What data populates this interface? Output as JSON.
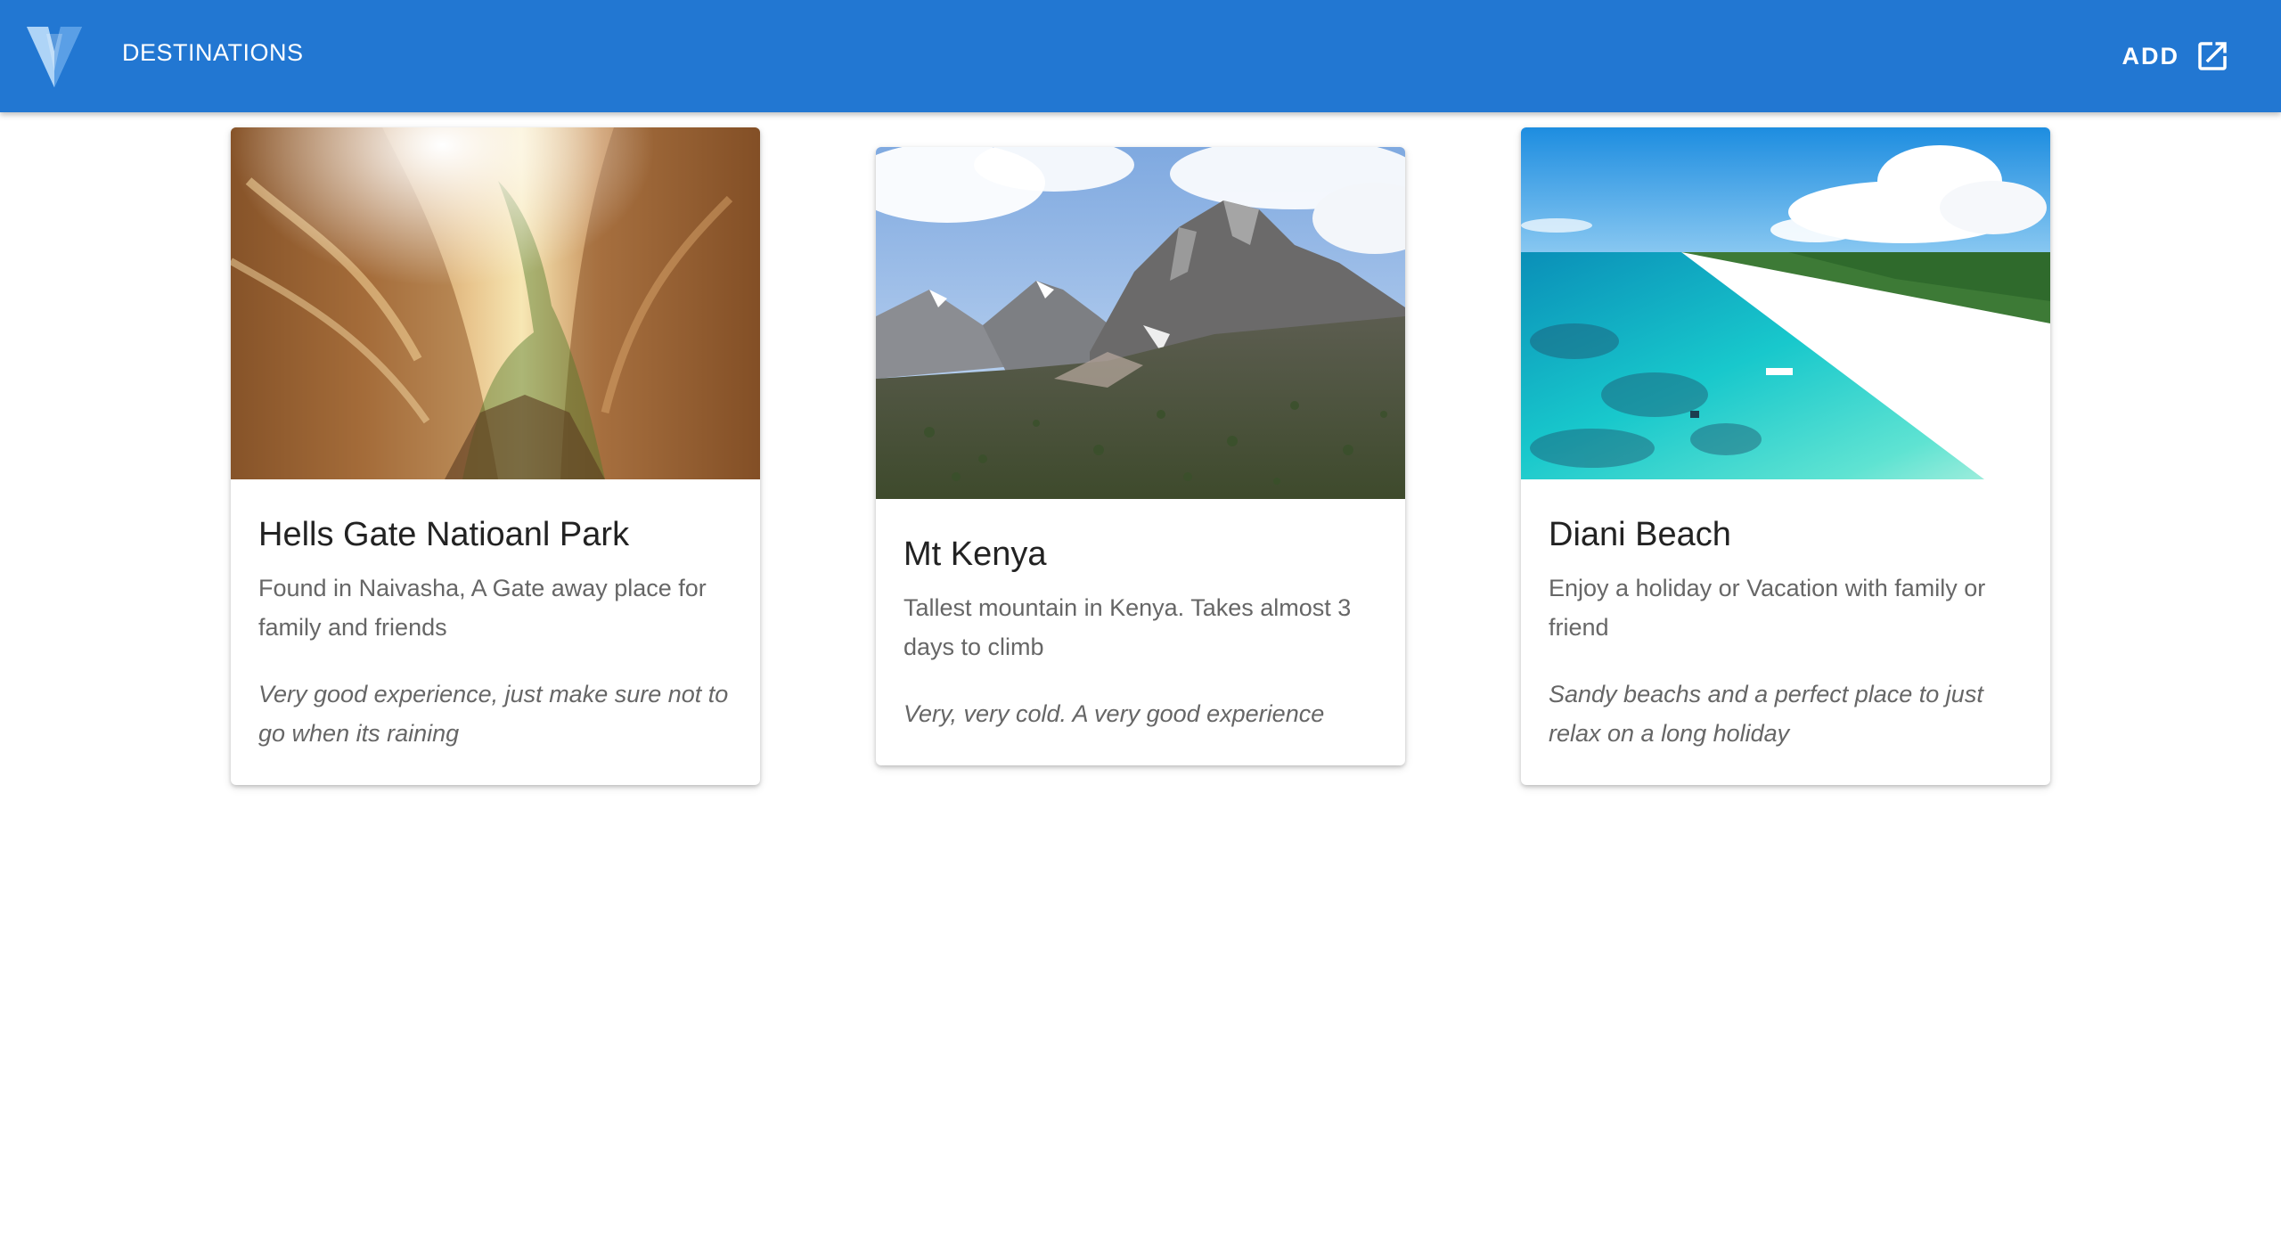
{
  "app": {
    "title": "DESTINATIONS",
    "add_label": "ADD",
    "bar_color": "#2277d2",
    "logo_icon": "vuetify-logo-icon",
    "add_icon": "open-in-new-icon"
  },
  "cards": [
    {
      "title": "Hells Gate Natioanl Park",
      "description": "Found in Naivasha, A Gate away place for family and friends",
      "review": "Very good experience, just make sure not to go when its raining",
      "image": "canyon-photo"
    },
    {
      "title": "Mt Kenya",
      "description": "Tallest mountain in Kenya. Takes almost 3 days to climb",
      "review": "Very, very cold. A very good experience",
      "image": "mountain-photo"
    },
    {
      "title": "Diani Beach",
      "description": "Enjoy a holiday or Vacation with family or friend",
      "review": "Sandy beachs and a perfect place to just relax on a long holiday",
      "image": "beach-photo"
    }
  ]
}
